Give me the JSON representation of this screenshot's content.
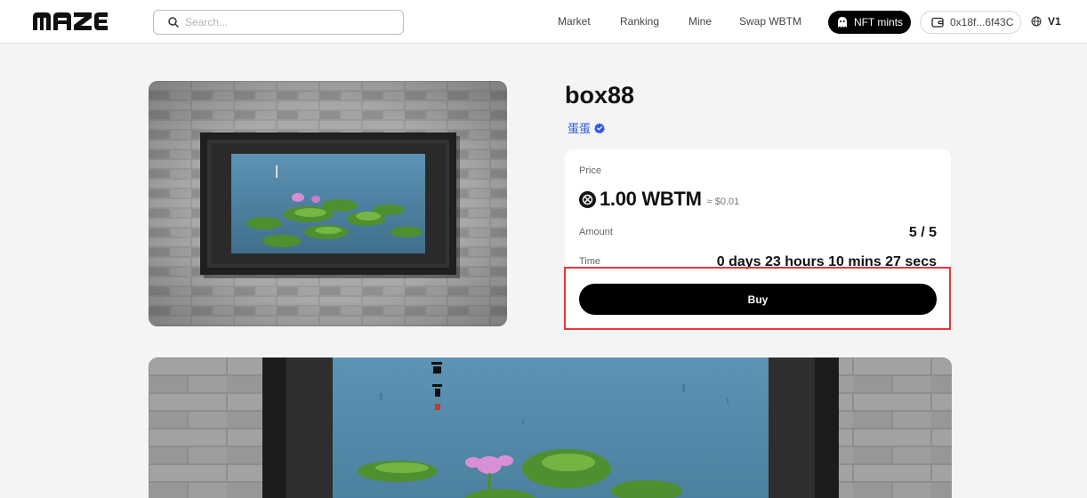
{
  "header": {
    "brand": "MAZE",
    "search_placeholder": "Search...",
    "nav": [
      {
        "label": "Market"
      },
      {
        "label": "Ranking"
      },
      {
        "label": "Mine"
      },
      {
        "label": "Swap WBTM"
      }
    ],
    "nft_mints_label": "NFT mints",
    "wallet_address": "0x18f...6f43C",
    "version_label": "V1",
    "icons": [
      "search-icon",
      "ghost-icon",
      "wallet-icon",
      "globe-icon"
    ]
  },
  "nft": {
    "title": "box88",
    "creator": "蛋蛋",
    "creator_verified": true,
    "price_label": "Price",
    "price_value": "1.00 WBTM",
    "price_usd": "≈ $0.01",
    "amount_label": "Amount",
    "amount_value": "5 / 5",
    "time_label": "Time",
    "time_value": "0 days 23 hours 10 mins 27 secs",
    "buy_label": "Buy"
  },
  "colors": {
    "accent": "#000000",
    "verified": "#2f56e0",
    "highlight": "#e53935",
    "background": "#f4f4f4"
  }
}
